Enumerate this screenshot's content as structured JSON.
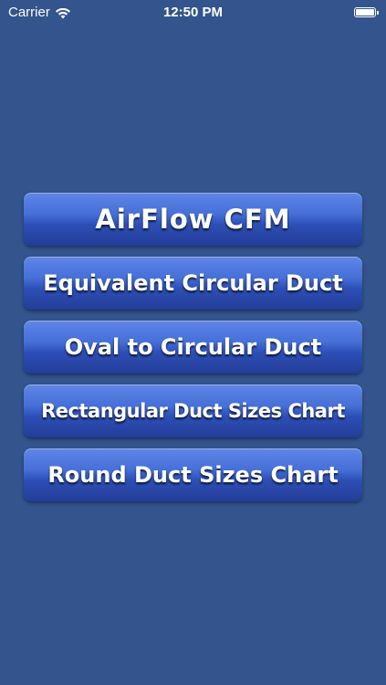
{
  "status_bar": {
    "carrier": "Carrier",
    "time": "12:50 PM",
    "wifi_icon": "wifi-icon",
    "battery_icon": "battery-icon"
  },
  "menu": {
    "items": [
      {
        "label": "AirFlow CFM"
      },
      {
        "label": "Equivalent Circular Duct"
      },
      {
        "label": "Oval to Circular Duct"
      },
      {
        "label": "Rectangular Duct Sizes Chart"
      },
      {
        "label": "Round Duct Sizes Chart"
      }
    ]
  },
  "colors": {
    "background": "#33548c",
    "button_top": "#5f86e6",
    "button_bottom": "#233d98",
    "text": "#ffffff"
  }
}
